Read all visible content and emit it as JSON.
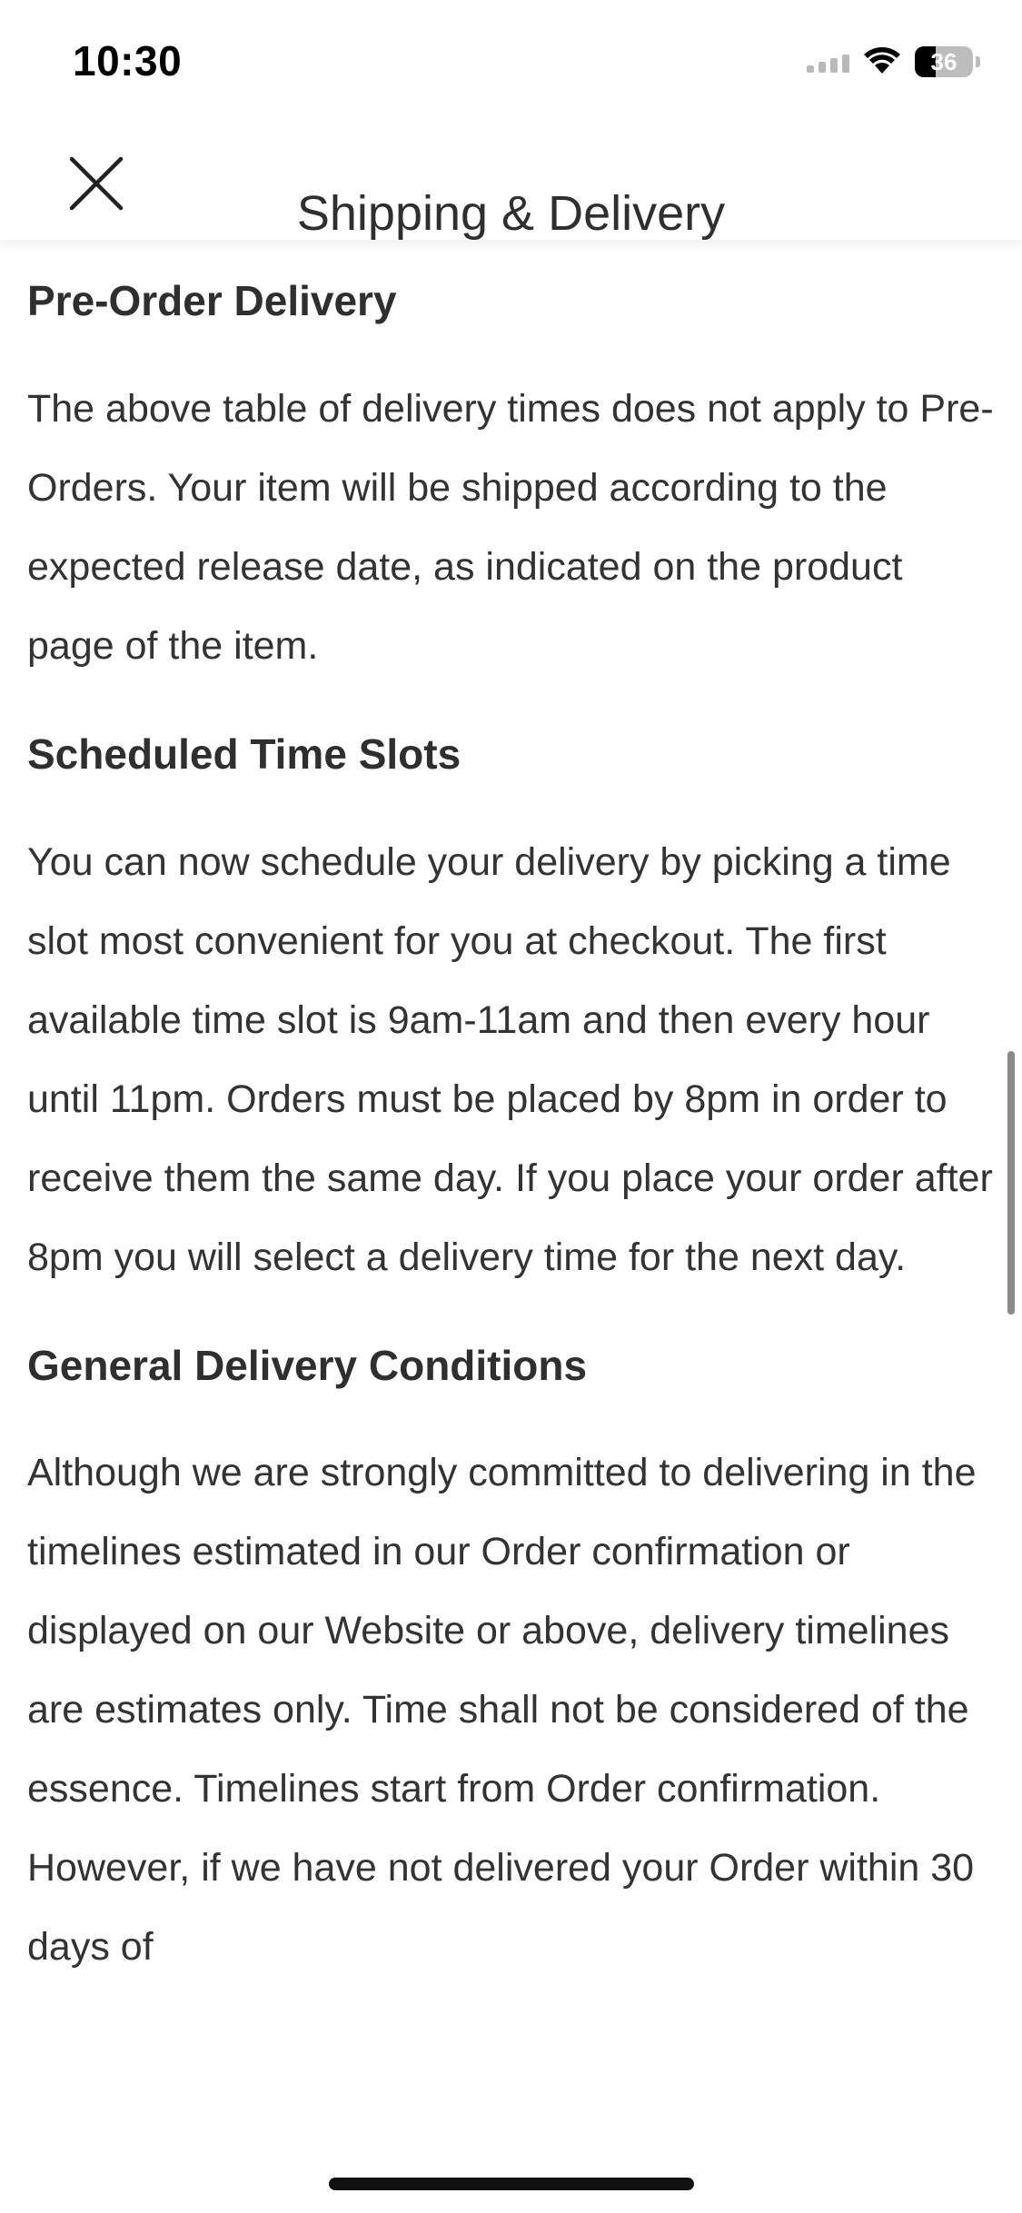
{
  "status_bar": {
    "time": "10:30",
    "battery_level": "36",
    "icons": [
      "signal-icon",
      "wifi-icon",
      "battery-icon"
    ]
  },
  "nav": {
    "title": "Shipping & Delivery",
    "close_icon": "close-icon"
  },
  "sections": [
    {
      "heading": "Pre-Order Delivery",
      "body": "The above table of delivery times does not apply to Pre-Orders. Your item will be shipped according to the expected release date, as indicated on the product page of the item."
    },
    {
      "heading": "Scheduled Time Slots",
      "body": "You can now schedule your delivery by picking a time slot most convenient for you at checkout. The first available time slot is 9am-11am and then every hour until 11pm. Orders must be placed by 8pm in order to receive them the same day. If you place your order after 8pm you will select a delivery time for the next day."
    },
    {
      "heading": "General Delivery Conditions",
      "body": "Although we are strongly committed to delivering in the timelines estimated in our Order confirmation or displayed on our Website or above, delivery timelines are estimates only. Time shall not be considered of the essence. Timelines start from Order confirmation. However, if we have not delivered your Order within 30 days of"
    }
  ],
  "colors": {
    "background": "#ffffff",
    "text": "#333333",
    "heading": "#2f2f2f"
  }
}
